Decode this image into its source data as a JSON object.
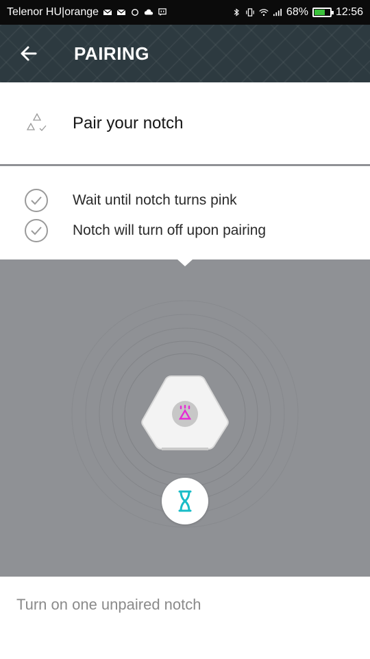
{
  "status_bar": {
    "carrier": "Telenor HU|orange",
    "battery_percent": "68%",
    "battery_level": 0.68,
    "time": "12:56",
    "icons": [
      "mail-icon",
      "mail-icon",
      "sync-icon",
      "cloud-icon",
      "chat-icon",
      "bluetooth-icon",
      "vibrate-icon",
      "wifi-icon",
      "signal-icon",
      "battery-icon"
    ]
  },
  "app_bar": {
    "title": "PAIRING",
    "back_icon": "arrow-left-icon"
  },
  "header": {
    "title": "Pair your notch",
    "icon": "pair-triangles-icon"
  },
  "instructions": [
    {
      "text": "Wait until notch turns pink",
      "icon": "check-circle-icon"
    },
    {
      "text": "Notch will turn off upon pairing",
      "icon": "check-circle-icon"
    }
  ],
  "illustration": {
    "device_icon": "notch-device-icon",
    "status_icon": "hourglass-icon",
    "accent_pink": "#e62bd5",
    "accent_teal": "#18bcc7",
    "background": "#8f9195"
  },
  "footer": {
    "text": "Turn on one unpaired notch"
  }
}
